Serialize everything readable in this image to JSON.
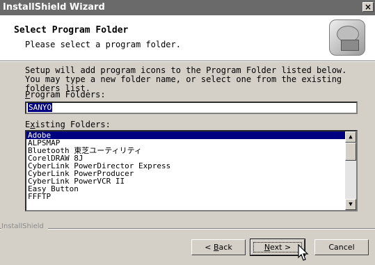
{
  "window": {
    "title": "InstallShield Wizard",
    "close_glyph": "×"
  },
  "header": {
    "title": "Select Program Folder",
    "subtitle": "Please select a program folder.",
    "icon": "installer-disk-icon"
  },
  "description": "Setup will add program icons to the Program Folder listed below. You may type a new folder name, or select one from the existing folders list.",
  "program_folders": {
    "label_prefix": "",
    "label_hotkey": "P",
    "label_rest": "rogram Folders:",
    "value": "SANYO"
  },
  "existing_folders": {
    "label_prefix": "E",
    "label_hotkey": "x",
    "label_rest": "isting Folders:",
    "items": [
      "Adobe",
      "ALPSMAP",
      "Bluetooth 東芝ユーティリティ",
      "CorelDRAW 8J",
      "CyberLink PowerDirector Express",
      "CyberLink PowerProducer",
      "CyberLink PowerVCR II",
      "Easy Button",
      "FFFTP"
    ],
    "selected_index": 0
  },
  "footer": {
    "brand": "InstallShield"
  },
  "buttons": {
    "back": {
      "prefix": "< ",
      "hotkey": "B",
      "rest": "ack"
    },
    "next": {
      "prefix": "",
      "hotkey": "N",
      "rest": "ext >"
    },
    "cancel": "Cancel"
  },
  "scrollbar": {
    "up_glyph": "▲",
    "down_glyph": "▼"
  },
  "colors": {
    "selection": "#000080",
    "dialog_face": "#d4d0c8",
    "titlebar": "#6a6a6a"
  }
}
